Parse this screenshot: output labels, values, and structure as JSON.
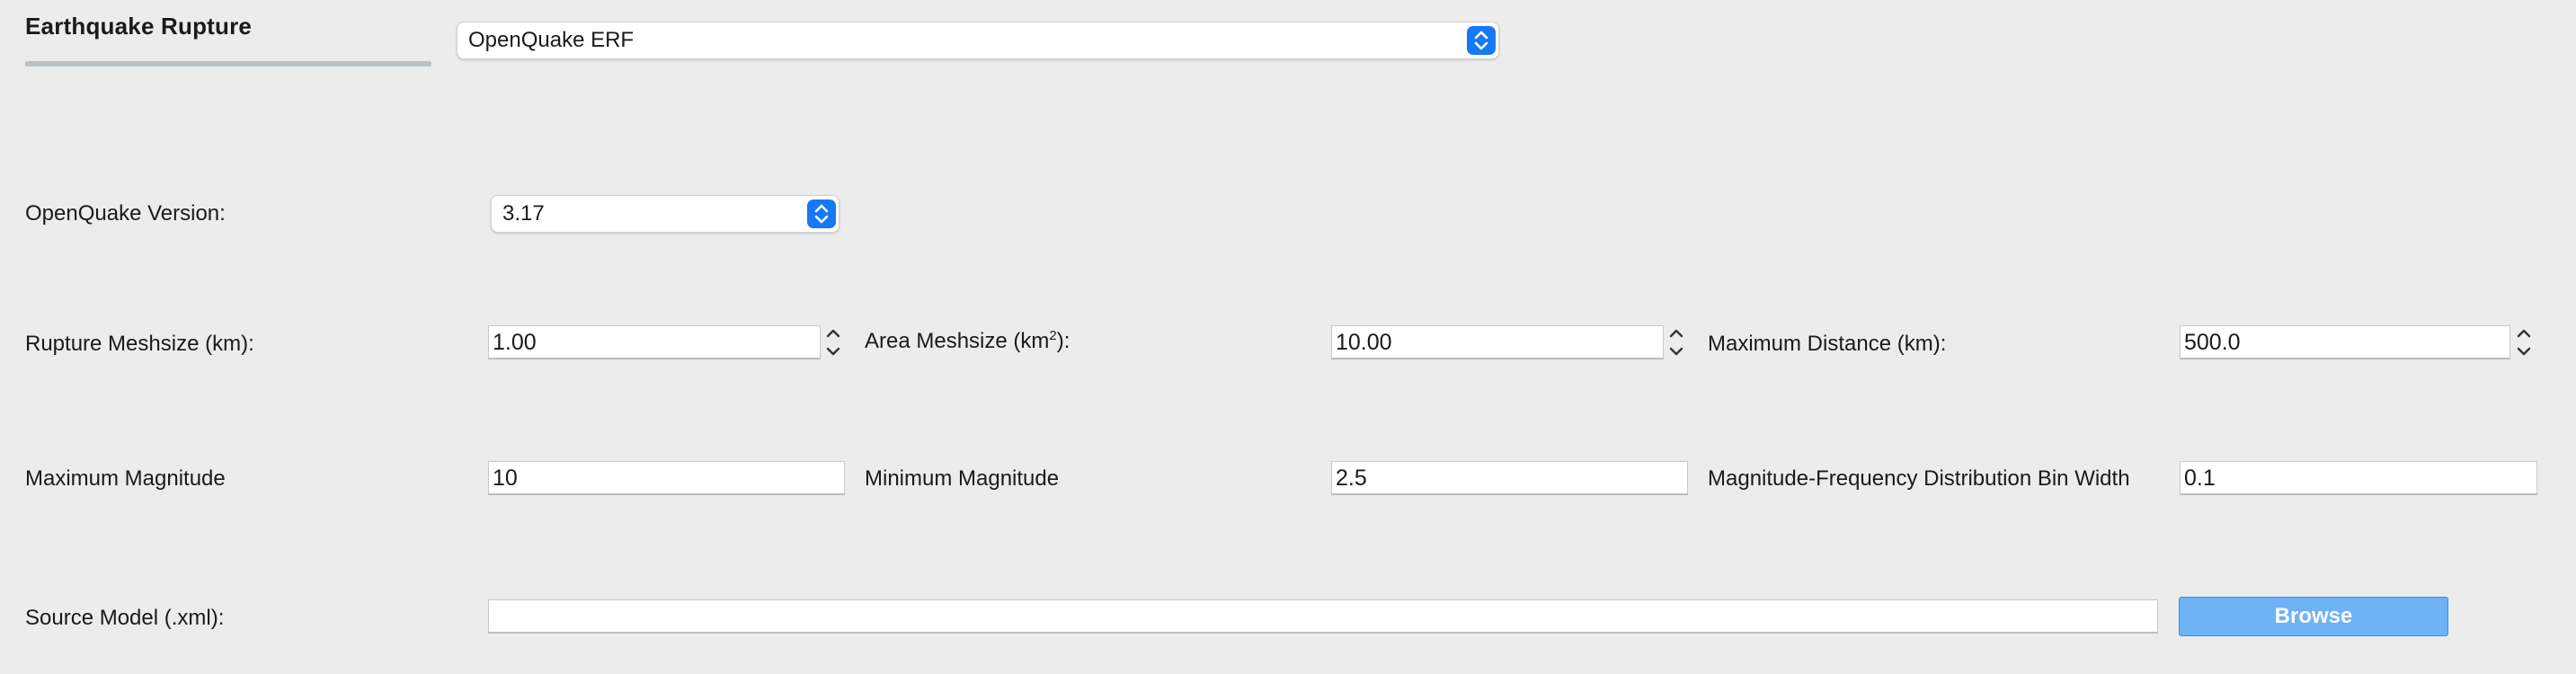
{
  "section": {
    "title": "Earthquake Rupture"
  },
  "erf_select": {
    "value": "OpenQuake ERF"
  },
  "version": {
    "label": "OpenQuake Version:",
    "value": "3.17"
  },
  "rupture_meshsize": {
    "label": "Rupture Meshsize (km):",
    "value": "1.00"
  },
  "area_meshsize": {
    "label_prefix": "Area Meshsize (km",
    "label_sup": "2",
    "label_suffix": "):",
    "value": "10.00"
  },
  "maximum_distance": {
    "label": "Maximum Distance (km):",
    "value": "500.0"
  },
  "maximum_magnitude": {
    "label": "Maximum Magnitude",
    "value": "10"
  },
  "minimum_magnitude": {
    "label": "Minimum Magnitude",
    "value": "2.5"
  },
  "bin_width": {
    "label": "Magnitude-Frequency Distribution Bin Width",
    "value": "0.1"
  },
  "source_model": {
    "label": "Source Model (.xml):",
    "value": "",
    "browse_label": "Browse"
  },
  "icons": {
    "combo_arrows": "up-down-chevron-icon",
    "stepper": "stepper-icon"
  },
  "colors": {
    "accent": "#1679f3",
    "browse_button": "#6db3f5",
    "background": "#ececec"
  }
}
